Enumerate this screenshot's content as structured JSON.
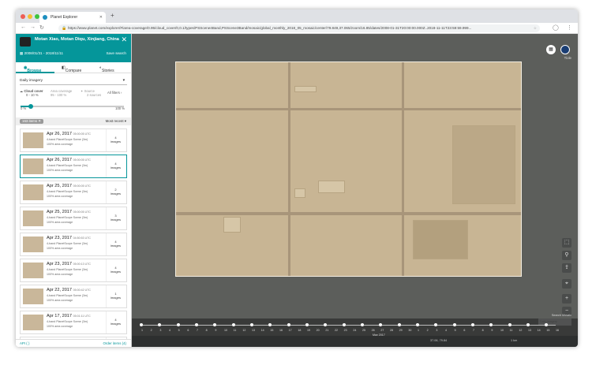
{
  "browser": {
    "tab_title": "Planet Explorer",
    "url": "https://www.planet.com/explorer/#/area-coverage/0.95/cloud_cover/0,0.1/types/PSScene4Band,PSScene3Band/mosaic/global_monthly_2018_05_mosaic/center/79.849,37.065/zoom/16.85/dates/2008-01-31T20:00:00.000Z..2018-11-11T23:59:59.999...",
    "colors": {
      "close": "#ee5e55",
      "min": "#f6be32",
      "max": "#3ec43d"
    }
  },
  "sidebar": {
    "location": "Motan Xiao, Motan Diqu, Xinjiang, China",
    "dates": "2008/01/31 - 2018/11/11",
    "save_search": "Save search",
    "modes": [
      "Browse",
      "Compare",
      "Stories"
    ],
    "dropdown": "Daily imagery",
    "filters": {
      "cloud_label": "Cloud cover",
      "cloud_value": "0 - 10 %",
      "area_label": "Area coverage",
      "area_value": "95 - 100 %",
      "source_label": "Source",
      "source_value": "2 sources",
      "all_filters": "All filters"
    },
    "slider_min": "0 %",
    "slider_max": "100 %",
    "slider": {
      "low": 0.1,
      "high": 1.0
    },
    "list_count": "163 items",
    "sort": "Most recent",
    "cards": [
      {
        "date": "Apr 26, 2017",
        "time": "05:00:05 UTC",
        "line2": "4-band PlanetScope Scene (3m)",
        "line3": "100% area coverage",
        "count": "4",
        "unit": "images",
        "selected": false
      },
      {
        "date": "Apr 26, 2017",
        "time": "05:00:05 UTC",
        "line2": "4-band PlanetScope Scene (3m)",
        "line3": "100% area coverage",
        "count": "4",
        "unit": "images",
        "selected": true
      },
      {
        "date": "Apr 25, 2017",
        "time": "05:00:05 UTC",
        "line2": "4-band PlanetScope Scene (3m)",
        "line3": "100% area coverage",
        "count": "2",
        "unit": "images",
        "selected": false
      },
      {
        "date": "Apr 25, 2017",
        "time": "05:00:05 UTC",
        "line2": "4-band PlanetScope Scene (3m)",
        "line3": "100% area coverage",
        "count": "3",
        "unit": "images",
        "selected": false
      },
      {
        "date": "Apr 23, 2017",
        "time": "04:50:53 UTC",
        "line2": "4-band PlanetScope Scene (3m)",
        "line3": "100% area coverage",
        "count": "4",
        "unit": "images",
        "selected": false
      },
      {
        "date": "Apr 23, 2017",
        "time": "05:00:13 UTC",
        "line2": "4-band PlanetScope Scene (3m)",
        "line3": "100% area coverage",
        "count": "4",
        "unit": "images",
        "selected": false
      },
      {
        "date": "Apr 22, 2017",
        "time": "05:00:42 UTC",
        "line2": "4-band PlanetScope Scene (3m)",
        "line3": "100% area coverage",
        "count": "1",
        "unit": "images",
        "selected": false
      },
      {
        "date": "Apr 17, 2017",
        "time": "05:01:11 UTC",
        "line2": "4-band PlanetScope Scene (3m)",
        "line3": "100% area coverage",
        "count": "4",
        "unit": "images",
        "selected": false
      },
      {
        "date": "Mar 15, 2017",
        "time": "05:00:11 UTC",
        "line2": "4-band PlanetScope Scene (3m)",
        "line3": "100% area coverage",
        "count": "2",
        "unit": "images",
        "selected": false
      }
    ],
    "footer_left": "API ( )",
    "footer_right": "Order items (4)"
  },
  "map": {
    "user": "Tiole",
    "timeline_ticks": [
      "1",
      "2",
      "3",
      "4",
      "5",
      "6",
      "7",
      "8",
      "9",
      "10",
      "11",
      "12",
      "13",
      "14",
      "15",
      "16",
      "17",
      "18",
      "19",
      "20",
      "21",
      "22",
      "23",
      "24",
      "25",
      "26",
      "27",
      "28",
      "29",
      "30",
      "1",
      "2",
      "3",
      "4",
      "5",
      "6",
      "7",
      "8",
      "9",
      "10",
      "11",
      "12",
      "13",
      "14",
      "15",
      "16"
    ],
    "month": "May 2017",
    "zoom_label": "Search Mosaic",
    "zoom_placeholder": "Daily imagery",
    "status": {
      "coords": "37.06, 79.84",
      "scale": "1 km"
    }
  }
}
